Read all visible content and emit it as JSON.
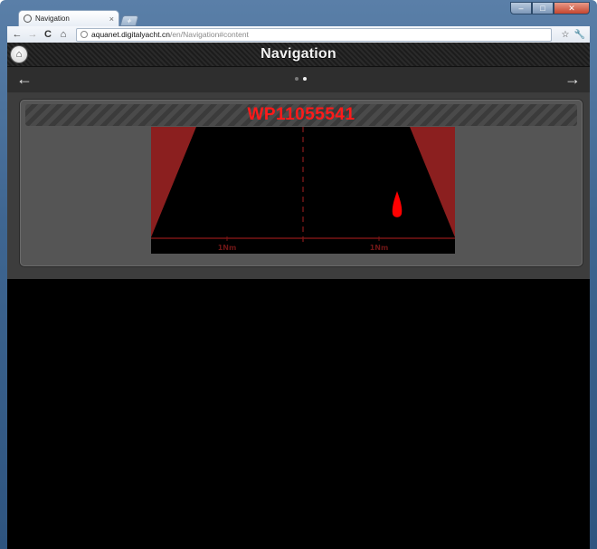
{
  "browser": {
    "tab_title": "Navigation",
    "tab_close": "×",
    "new_tab": "+",
    "url_host": "aquanet.digitalyacht.cn",
    "url_path": "/en/Navigation#content",
    "back_glyph": "←",
    "forward_glyph": "→",
    "reload_glyph": "C",
    "home_glyph": "⌂",
    "star_glyph": "☆",
    "wrench_glyph": "🔧",
    "window_min": "–",
    "window_max": "□",
    "window_close": "✕"
  },
  "app": {
    "title": "Navigation",
    "home_glyph": "⌂",
    "prev_arrow": "←",
    "next_arrow": "→",
    "pager_count": 2,
    "pager_active_index": 1
  },
  "panel": {
    "waypoint_name": "WP11055541",
    "scale_left": "1Nm",
    "scale_right": "1Nm"
  },
  "colors": {
    "accent": "#ff1a1a",
    "hazard_red": "#8b1f1f",
    "boat_red": "#ff0000",
    "page_background": "#000000"
  },
  "icons": {
    "home": "home-icon",
    "boat": "boat-icon",
    "tab": "globe-icon",
    "url": "globe-icon"
  }
}
